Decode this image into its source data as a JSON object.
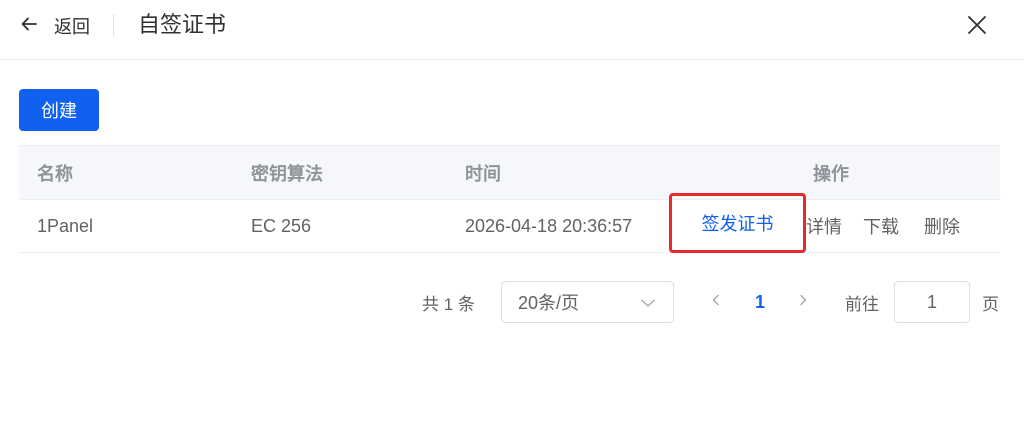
{
  "header": {
    "back_label": "返回",
    "title": "自签证书"
  },
  "toolbar": {
    "create_label": "创建"
  },
  "table": {
    "columns": [
      "名称",
      "密钥算法",
      "时间",
      "操作"
    ],
    "rows": [
      {
        "name": "1Panel",
        "algorithm": "EC 256",
        "time": "2026-04-18 20:36:57",
        "actions": {
          "issue": "签发证书",
          "details": "详情",
          "download": "下载",
          "delete": "删除"
        }
      }
    ]
  },
  "pagination": {
    "total_text": "共 1 条",
    "page_size": "20条/页",
    "current_page": "1",
    "goto_label": "前往",
    "goto_value": "1",
    "page_suffix": "页"
  },
  "colors": {
    "primary": "#1161f0",
    "highlight_border": "#e8292e",
    "header_bg": "#f5f7fa"
  },
  "icons": {
    "back": "arrow-left-icon",
    "close": "close-icon",
    "select": "chevron-down-icon",
    "prev": "chevron-left-icon",
    "next": "chevron-right-icon"
  }
}
